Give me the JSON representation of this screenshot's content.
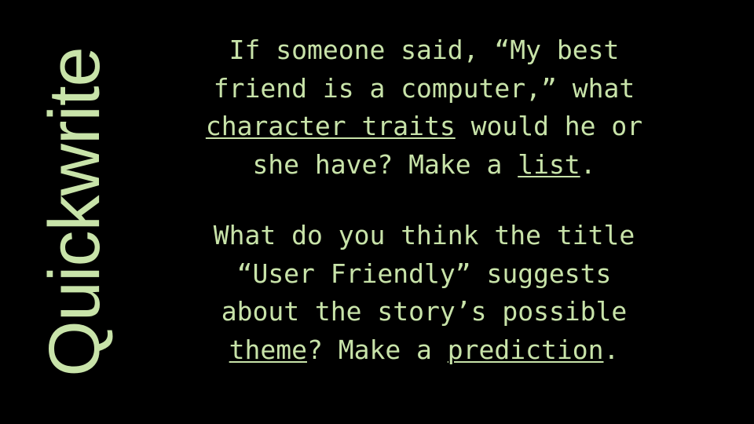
{
  "slide": {
    "background_color": "#000000",
    "text_color": "#c8e3a9",
    "side_title": "Quickwrite"
  },
  "content": {
    "paragraph_1": {
      "lines": [
        "If someone said, “My best",
        "friend is a computer,” what",
        "character traits would he or",
        "she have? Make a list."
      ],
      "segments_line3": {
        "underlined": "character traits",
        "plain": " would he or"
      },
      "segments_line4": {
        "plain_before": "she have? Make a ",
        "underlined": "list",
        "plain_after": "."
      }
    },
    "paragraph_2": {
      "lines": [
        "What do you think the title",
        "“User Friendly” suggests",
        "about the story’s possible",
        "theme? Make a prediction."
      ],
      "segments_line4": {
        "underlined_1": "theme",
        "middle": "? Make a ",
        "underlined_2": "prediction",
        "plain_after": "."
      }
    }
  }
}
